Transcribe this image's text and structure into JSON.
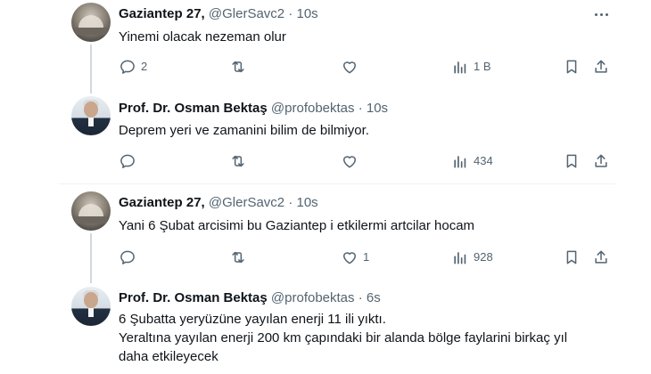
{
  "tweets": [
    {
      "name": "Gaziantep 27,",
      "handle": "@GlerSavc2",
      "dot": "·",
      "time": "10s",
      "text_lines": [
        "Yinemi olacak nezeman olur"
      ],
      "replies": "2",
      "likes": "",
      "views": "1 B"
    },
    {
      "name": "Prof. Dr. Osman Bektaş",
      "handle": "@profobektas",
      "dot": "·",
      "time": "10s",
      "text_lines": [
        "Deprem yeri ve zamanini bilim de bilmiyor."
      ],
      "replies": "",
      "likes": "",
      "views": "434"
    },
    {
      "name": "Gaziantep 27,",
      "handle": "@GlerSavc2",
      "dot": "·",
      "time": "10s",
      "text_lines": [
        "Yani 6 Şubat arcisimi bu Gaziantep i etkilermi artcilar hocam"
      ],
      "replies": "",
      "likes": "1",
      "views": "928"
    },
    {
      "name": "Prof. Dr. Osman Bektaş",
      "handle": "@profobektas",
      "dot": "·",
      "time": "6s",
      "text_lines": [
        "6 Şubatta yeryüzüne yayılan enerji 11 ili yıktı.",
        "Yeraltına yayılan enerji 200 km çapındaki bir alanda bölge faylarini birkaç yıl",
        "daha  etkileyecek"
      ]
    }
  ],
  "icons": {
    "reply": "reply-icon",
    "retweet": "retweet-icon",
    "like": "heart-icon",
    "views": "views-icon",
    "bookmark": "bookmark-icon",
    "share": "share-icon",
    "more": "more-icon"
  },
  "colors": {
    "text": "#0f1419",
    "secondary": "#536471",
    "thread_line": "#cfd9de",
    "divider": "#eff3f4"
  }
}
